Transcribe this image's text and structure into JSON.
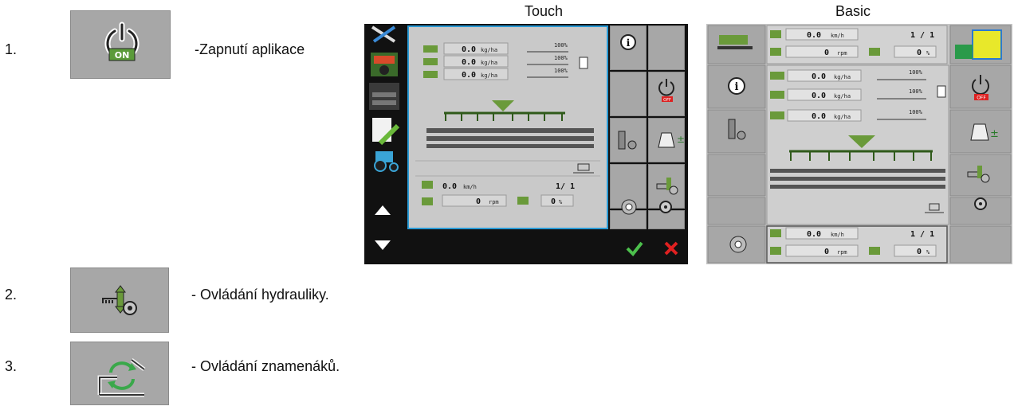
{
  "steps": [
    {
      "number": "1.",
      "text": "-Zapnutí aplikace",
      "icon": "power-on-icon",
      "badge": "ON"
    },
    {
      "number": "2.",
      "text": "- Ovládání hydrauliky.",
      "icon": "hydraulics-icon"
    },
    {
      "number": "3.",
      "text": "- Ovládání znamenáků.",
      "icon": "markers-icon"
    }
  ],
  "touch": {
    "caption": "Touch",
    "rates": [
      "0.0",
      "0.0",
      "0.0"
    ],
    "rate_unit": "kg/ha",
    "bar_pct": [
      "100%",
      "100%",
      "100%"
    ],
    "speed": "0.0",
    "speed_unit": "km/h",
    "counter": "1/ 1",
    "rpm": "0",
    "rpm_unit": "rpm",
    "percent": "0",
    "percent_unit": "%",
    "off_label": "OFF"
  },
  "basic": {
    "caption": "Basic",
    "speed": "0.0",
    "speed_unit": "km/h",
    "counter": "1 / 1",
    "rpm": "0",
    "rpm_unit": "rpm",
    "percent": "0",
    "percent_unit": "%",
    "rates": [
      "0.0",
      "0.0",
      "0.0"
    ],
    "rate_unit": "kg/ha",
    "bar_pct": [
      "100%",
      "100%",
      "100%"
    ],
    "off_label": "OFF"
  },
  "colors": {
    "panel_gray": "#a7a7a7",
    "screen_bg": "#c9c9c9",
    "accent_green": "#6a9a3a",
    "touch_dark": "#111111",
    "touch_border": "#2a9bd6",
    "ok_green": "#4cc04c",
    "cancel_red": "#e02020"
  }
}
